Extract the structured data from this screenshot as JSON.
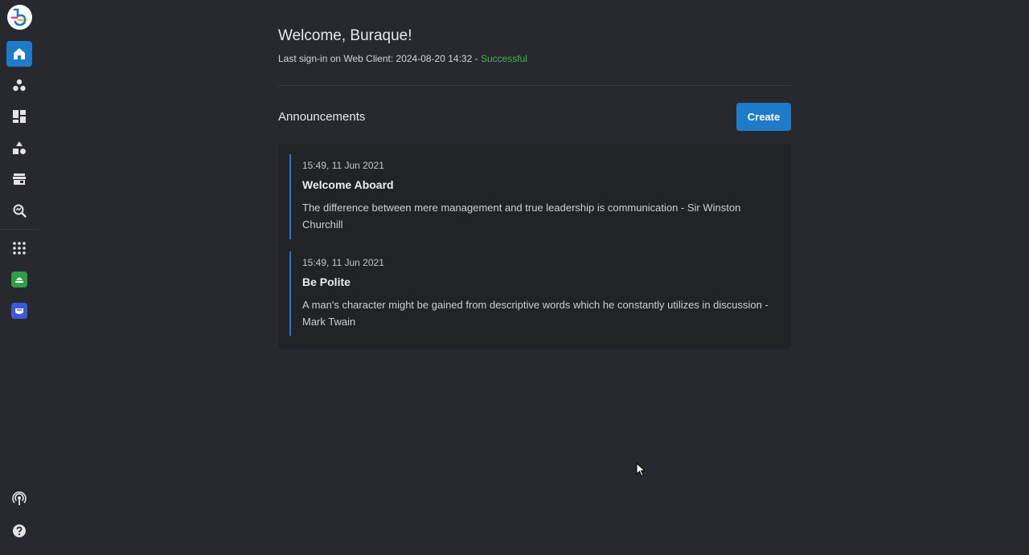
{
  "sidebar": {
    "logo": "brand-logo",
    "top_items": [
      {
        "name": "nav-home",
        "icon": "home-icon",
        "active": true
      },
      {
        "name": "nav-groups",
        "icon": "circles-icon"
      },
      {
        "name": "nav-dashboard",
        "icon": "dashboard-icon"
      },
      {
        "name": "nav-shapes",
        "icon": "shapes-icon"
      },
      {
        "name": "nav-store",
        "icon": "store-icon"
      },
      {
        "name": "nav-analytics",
        "icon": "search-analytics-icon"
      }
    ],
    "app_items": [
      {
        "name": "nav-apps",
        "icon": "grid-icon"
      },
      {
        "name": "nav-app-green",
        "icon": "green-app-icon"
      },
      {
        "name": "nav-app-blue",
        "icon": "blue-app-icon"
      }
    ],
    "bottom_items": [
      {
        "name": "nav-broadcast",
        "icon": "broadcast-icon"
      },
      {
        "name": "nav-help",
        "icon": "help-icon"
      }
    ]
  },
  "header": {
    "welcome": "Welcome, Buraque!",
    "signin_prefix": "Last sign-in on Web Client: 2024-08-20 14:32 - ",
    "signin_status": "Successful"
  },
  "announcements": {
    "title": "Announcements",
    "create_label": "Create",
    "items": [
      {
        "date": "15:49, 11 Jun 2021",
        "title": "Welcome Aboard",
        "body": "The difference between mere management and true leadership is communication - Sir Winston Churchill"
      },
      {
        "date": "15:49, 11 Jun 2021",
        "title": "Be Polite",
        "body": "A man's character might be gained from descriptive words which he constantly utilizes in discussion - Mark Twain"
      }
    ]
  },
  "colors": {
    "background": "#28292e",
    "accent": "#1d7bc9",
    "success": "#3fb950",
    "card": "#222327"
  }
}
